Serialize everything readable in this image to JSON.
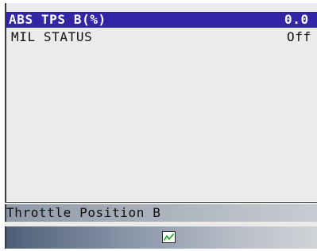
{
  "pid_list": {
    "rows": [
      {
        "label": "ABS TPS B(%)",
        "value": "0.0",
        "selected": true
      },
      {
        "label": "MIL STATUS",
        "value": "Off",
        "selected": false
      }
    ]
  },
  "status_bar": {
    "text": "Throttle Position B"
  },
  "toolbar": {
    "graph_icon": "graph-line-icon",
    "graph_icon_color": "#19a319"
  },
  "colors": {
    "selection_bg": "#3226a6",
    "screen_bg": "#ebebeb"
  }
}
